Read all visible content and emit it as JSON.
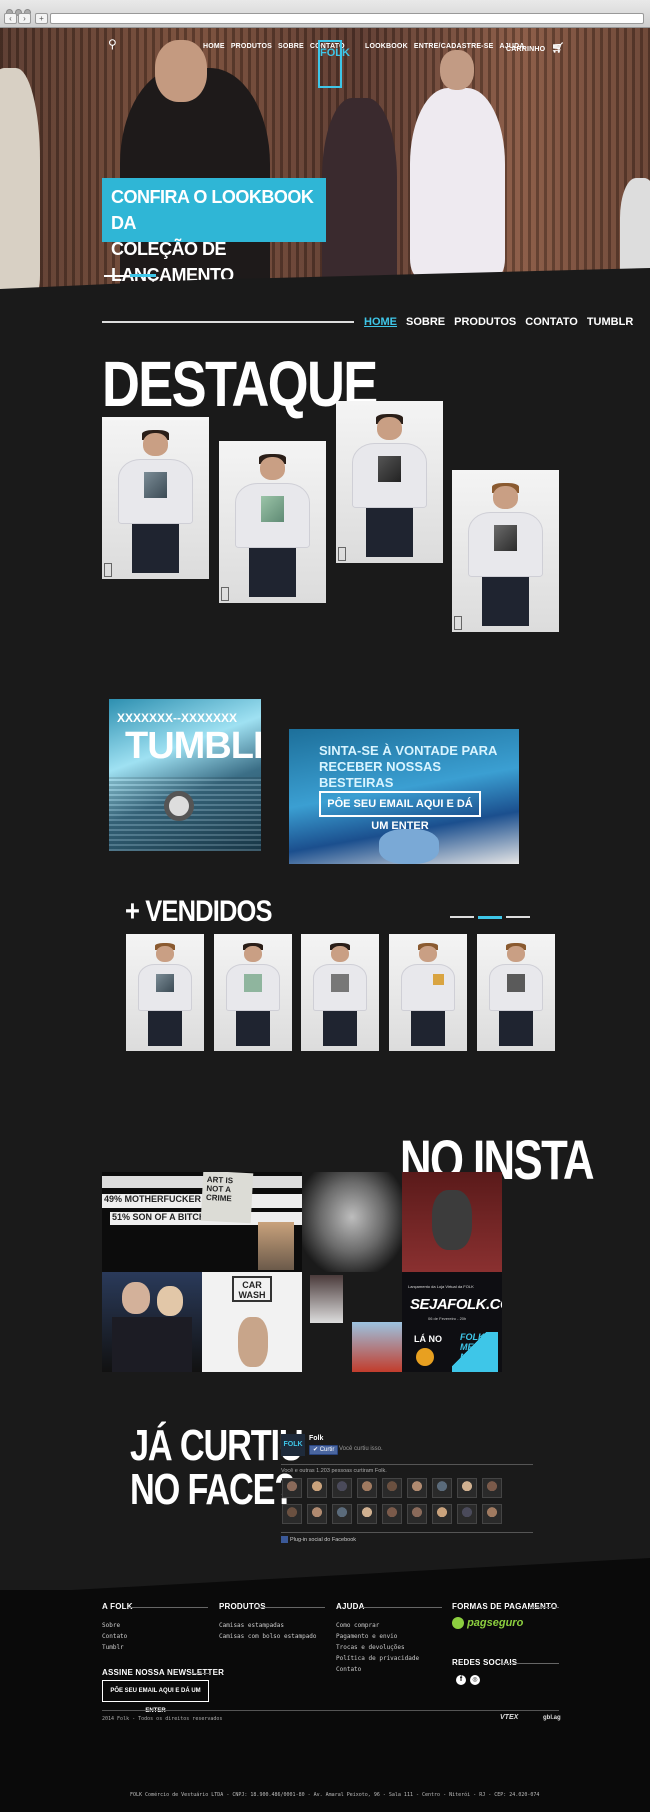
{
  "hero": {
    "nav_left": [
      "HOME",
      "PRODUTOS",
      "SOBRE",
      "CONTATO"
    ],
    "logo": "FOLK",
    "nav_right": [
      "LOOKBOOK",
      "ENTRE/CADASTRE-SE",
      "AJUDA"
    ],
    "cart": "CARRINHO",
    "lookbook_line1": "CONFIRA O LOOKBOOK DA",
    "lookbook_line2": "COLEÇÃO DE LANÇAMENTO"
  },
  "section_nav": [
    "HOME",
    "SOBRE",
    "PRODUTOS",
    "CONTATO",
    "TUMBLR"
  ],
  "destaque_title": "DESTAQUE",
  "tumblr": {
    "small": "XXXXXXX--XXXXXXX",
    "big": "TUMBLR"
  },
  "newsletter_banner": {
    "line1": "SINTA-SE À VONTADE PARA",
    "line2": "RECEBER NOSSAS BESTEIRAS",
    "button": "PÔE SEU EMAIL AQUI E DÁ UM ENTER"
  },
  "vendidos_title": "+ VENDIDOS",
  "insta_title": "NO INSTA",
  "insta": {
    "sign1": "49% MOTHERFUCKER",
    "sign2": "51% SON OF A BITCH",
    "art": "ART IS NOT A CRIME",
    "carwash": "CAR WASH",
    "promo_small": "Lançamento da Loja Virtual da FOLK",
    "promo_site": "SEJAFOLK.COM",
    "promo_date": "06 de Fevereiro - 20h",
    "promo_la": "LÁ NO",
    "promo_folk": "FOLK-ME NOW!"
  },
  "face_title_1": "JÁ CURTIU",
  "face_title_2": "NO FACE?",
  "fb": {
    "page": "Folk",
    "like": "Curtir",
    "you_like": "Você curtiu isso.",
    "count_text": "Você e outras 1.203 pessoas curtiram Folk.",
    "plugin": "Plug-in social do Facebook"
  },
  "footer": {
    "col1_title": "A FOLK",
    "col1_links": [
      "Sobre",
      "Contato",
      "Tumblr"
    ],
    "col2_title": "PRODUTOS",
    "col2_links": [
      "Camisas estampadas",
      "Camisas com bolso estampado"
    ],
    "col3_title": "AJUDA",
    "col3_links": [
      "Como comprar",
      "Pagamento e envio",
      "Trocas e devoluções",
      "Política de privacidade",
      "Contato"
    ],
    "col4_title": "FORMAS DE PAGAMENTO",
    "pagseguro": "pagseguro",
    "social_title": "REDES SOCIAIS",
    "newsletter_title": "ASSINE NOSSA NEWSLETTER",
    "newsletter_button": "PÔE SEU EMAIL AQUI E DÁ UM ENTER",
    "copyright": "2014 Folk - Todos os direitos reservados",
    "vtex": "VTEX",
    "gbx": "gbl.ag",
    "legal": "FOLK Comércio de Vestuário LTDA - CNPJ: 18.900.486/0001-80 - Av. Amaral Peixoto, 96 - Sala 111 - Centro - Niterói - RJ - CEP: 24.020-074"
  },
  "colors": {
    "accent": "#3ec6e8",
    "background": "#1a1a1a",
    "footer": "#0a0a0a"
  }
}
